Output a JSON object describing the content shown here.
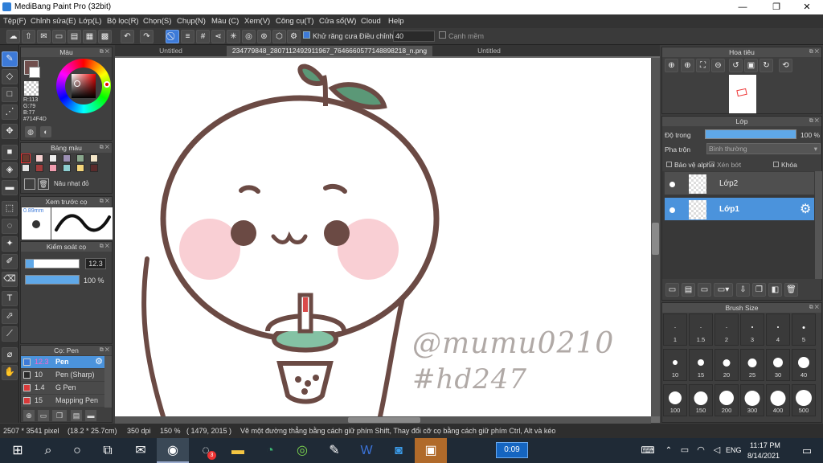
{
  "title": "MediBang Paint Pro (32bit)",
  "menu": [
    "Tệp(F)",
    "Chỉnh sửa(E)",
    "Lớp(L)",
    "Bộ lọc(R)",
    "Chọn(S)",
    "Chụp(N)",
    "Màu (C)",
    "Xem(V)",
    "Công cụ(T)",
    "Cửa sổ(W)",
    "Cloud",
    "Help"
  ],
  "toolbar": {
    "antialias_label": "Khử răng cưa",
    "adjust_label": "Điều chỉnh",
    "adjust_value": "40",
    "edge_label": "Cạnh mềm"
  },
  "tabs": [
    "Untitled",
    "234779848_2807112492911967_7646660577148898218_n.png",
    "Untitled"
  ],
  "color_panel": {
    "title": "Màu",
    "r": "R:113",
    "g": "G:79",
    "b": "B:77",
    "hex": "#714F4D",
    "primary": "#714F4D"
  },
  "palette_panel": {
    "title": "Bảng màu",
    "swatches": [
      "#6b3a2e",
      "#f7d0d0",
      "#eeeeee",
      "#9b8fb3",
      "#8aa88d",
      "#f4e6c8",
      "#e2e2e2",
      "#a33c3c",
      "#f09db0",
      "#8ecfd2",
      "#f5d67a",
      "#5a2b2b"
    ],
    "selected_name": "Nâu nhạt đỏ"
  },
  "preview_panel": {
    "title": "Xem trước cọ",
    "size": "0.89mm"
  },
  "brush_control": {
    "title": "Kiểm soát cọ",
    "size_value": "12.3",
    "size_fraction": 0.15,
    "opacity_value": "100 %",
    "opacity_fraction": 1.0
  },
  "brush_list": {
    "title": "Cọ: Pen",
    "items": [
      {
        "size": "12.3",
        "name": "Pen",
        "active": true,
        "color": "#3d7ad8"
      },
      {
        "size": "10",
        "name": "Pen (Sharp)",
        "active": false,
        "color": "#2a2a2a"
      },
      {
        "size": "1.4",
        "name": "G Pen",
        "active": false,
        "color": "#d93a3a"
      },
      {
        "size": "15",
        "name": "Mapping Pen",
        "active": false,
        "color": "#d93a3a"
      }
    ]
  },
  "navigator": {
    "title": "Hoa tiêu"
  },
  "layer_panel": {
    "title": "Lớp",
    "opacity_label": "Độ trong",
    "opacity_value": "100 %",
    "opacity_fraction": 1.0,
    "blend_label": "Pha trộn",
    "blend_value": "Bình thường",
    "protect_alpha": "Bảo vệ alpha",
    "clipping": "Xén bớt",
    "lock": "Khóa",
    "layers": [
      {
        "name": "Lớp2",
        "active": false
      },
      {
        "name": "Lớp1",
        "active": true
      }
    ]
  },
  "brush_size_panel": {
    "title": "Brush Size",
    "sizes": [
      "1",
      "1.5",
      "2",
      "3",
      "4",
      "5",
      "10",
      "15",
      "20",
      "25",
      "30",
      "40",
      "100",
      "150",
      "200",
      "300",
      "400",
      "500"
    ],
    "dot_fractions": [
      0.04,
      0.05,
      0.06,
      0.08,
      0.1,
      0.12,
      0.25,
      0.32,
      0.38,
      0.45,
      0.5,
      0.58,
      0.68,
      0.72,
      0.75,
      0.78,
      0.8,
      0.82
    ]
  },
  "canvas_text": {
    "watermark_line1": "@mumu0210",
    "watermark_line2": "#hd247"
  },
  "status": {
    "dimensions": "2507 * 3541 pixel",
    "cm": "(18.2 * 25.7cm)",
    "dpi": "350 dpi",
    "zoom": "150 %",
    "coords": "( 1479, 2015 )",
    "hint": "Vẽ một đường thẳng bằng cách giữ phím Shift, Thay đổi cỡ cọ bằng cách giữ phím Ctrl, Alt và kéo"
  },
  "taskbar": {
    "timer": "0:09",
    "lang": "ENG",
    "time": "11:17 PM",
    "date": "8/14/2021",
    "badge": "3"
  },
  "colors": {
    "accent": "#3d7ad8",
    "line": "#6b4a44",
    "cheek": "#f9cfd4",
    "leaf": "#5b9877",
    "cup": "#84c2a4",
    "straw": "#d94a4a"
  }
}
